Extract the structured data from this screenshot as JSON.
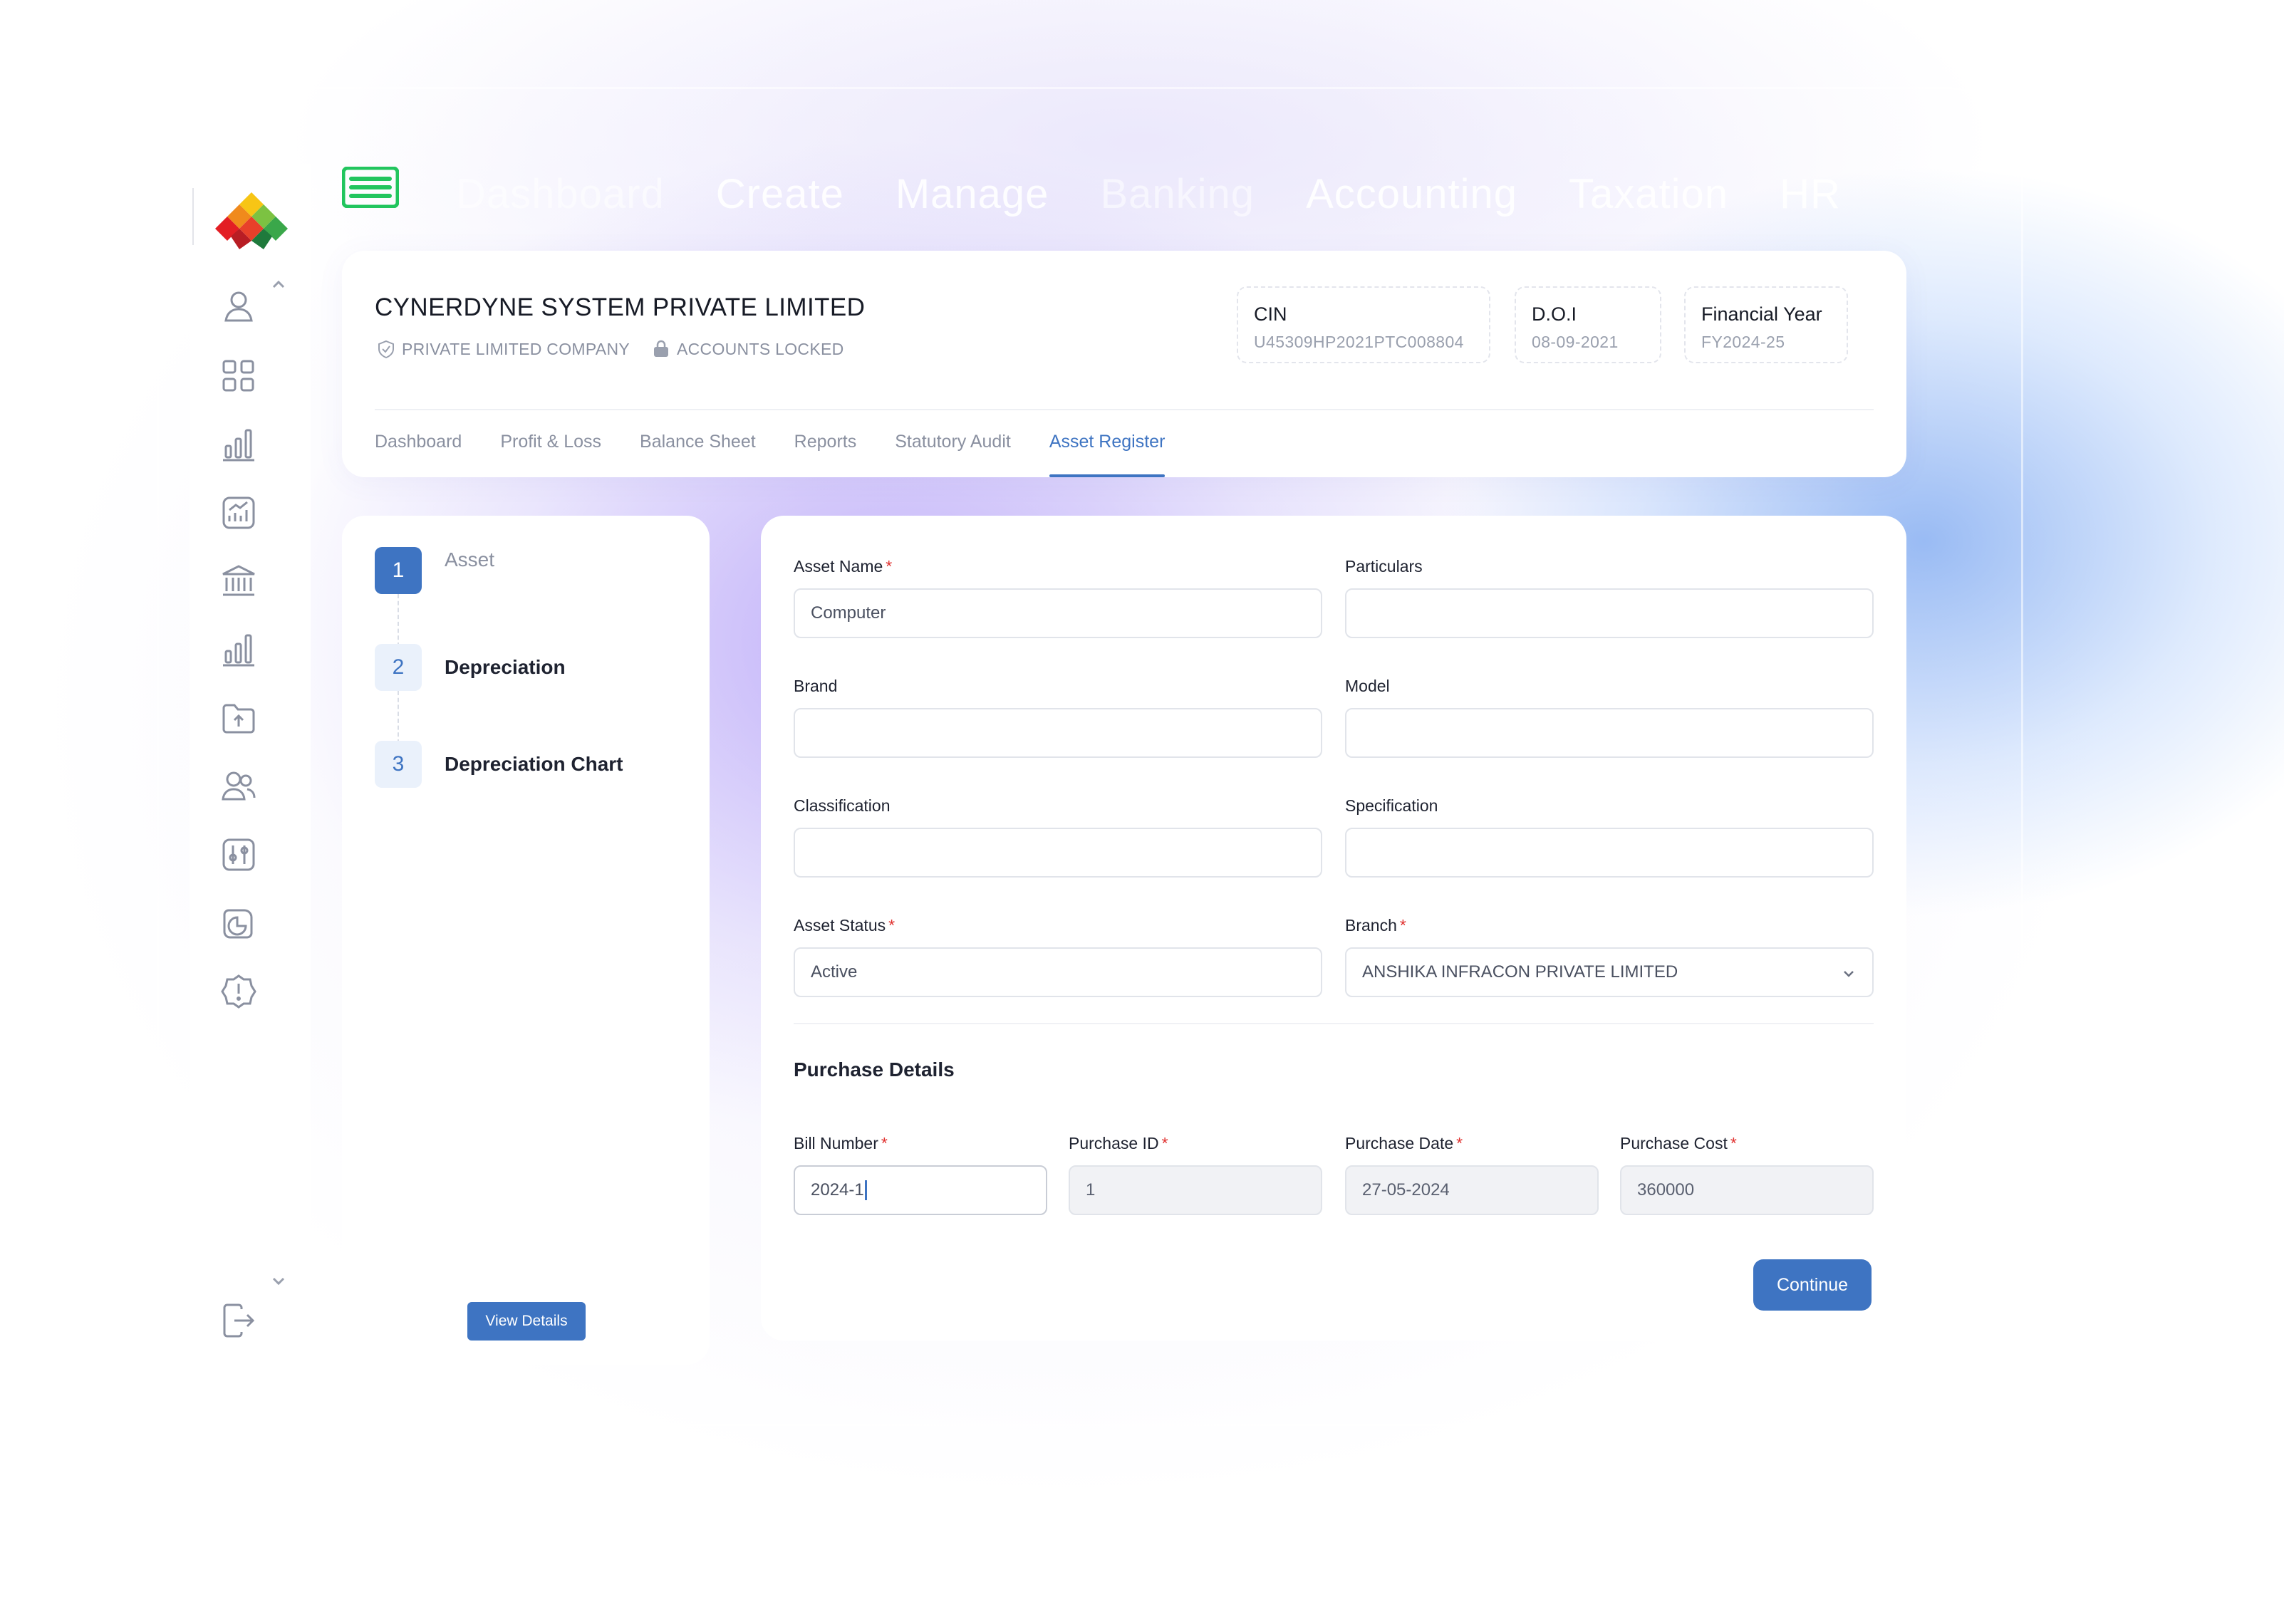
{
  "nav": {
    "items": [
      "Dashboard",
      "Create",
      "Manage",
      "Banking",
      "Accounting",
      "Taxation",
      "HR"
    ],
    "menu_icon": "hamburger-menu-icon"
  },
  "sidebar": {
    "icons": [
      "user-icon",
      "apps-grid-icon",
      "bar-chart-icon",
      "analytics-icon",
      "bank-icon",
      "bar-chart-icon",
      "folder-upload-icon",
      "users-icon",
      "settings-sliders-icon",
      "pie-chart-icon",
      "alert-badge-icon",
      "logout-icon"
    ]
  },
  "company": {
    "name": "CYNERDYNE SYSTEM PRIVATE LIMITED",
    "type": "PRIVATE LIMITED COMPANY",
    "status": "ACCOUNTS LOCKED"
  },
  "info": {
    "cin_label": "CIN",
    "cin_value": "U45309HP2021PTC008804",
    "doi_label": "D.O.I",
    "doi_value": "08-09-2021",
    "fy_label": "Financial Year",
    "fy_value": "FY2024-25"
  },
  "tabs": [
    "Dashboard",
    "Profit & Loss",
    "Balance Sheet",
    "Reports",
    "Statutory Audit",
    "Asset Register"
  ],
  "active_tab": "Asset Register",
  "steps": [
    {
      "num": "1",
      "label": "Asset"
    },
    {
      "num": "2",
      "label": "Depreciation"
    },
    {
      "num": "3",
      "label": "Depreciation Chart"
    }
  ],
  "view_details_label": "View Details",
  "form": {
    "asset_name": {
      "label": "Asset Name",
      "value": "Computer",
      "required": "*"
    },
    "particulars": {
      "label": "Particulars",
      "value": ""
    },
    "brand": {
      "label": "Brand",
      "value": ""
    },
    "model": {
      "label": "Model",
      "value": ""
    },
    "classification": {
      "label": "Classification",
      "value": ""
    },
    "specification": {
      "label": "Specification",
      "value": ""
    },
    "asset_status": {
      "label": "Asset Status",
      "value": "Active",
      "required": "*"
    },
    "branch": {
      "label": "Branch",
      "value": "ANSHIKA INFRACON PRIVATE LIMITED",
      "required": "*"
    }
  },
  "purchase": {
    "title": "Purchase Details",
    "bill_number": {
      "label": "Bill Number",
      "value": "2024-1",
      "required": "*"
    },
    "purchase_id": {
      "label": "Purchase ID",
      "value": "1",
      "required": "*"
    },
    "purchase_date": {
      "label": "Purchase Date",
      "value": "27-05-2024",
      "required": "*"
    },
    "purchase_cost": {
      "label": "Purchase Cost",
      "value": "360000",
      "required": "*"
    }
  },
  "continue_label": "Continue",
  "colors": {
    "accent": "#3e74c2",
    "required": "#e0302e",
    "menu_green": "#22c55e"
  }
}
